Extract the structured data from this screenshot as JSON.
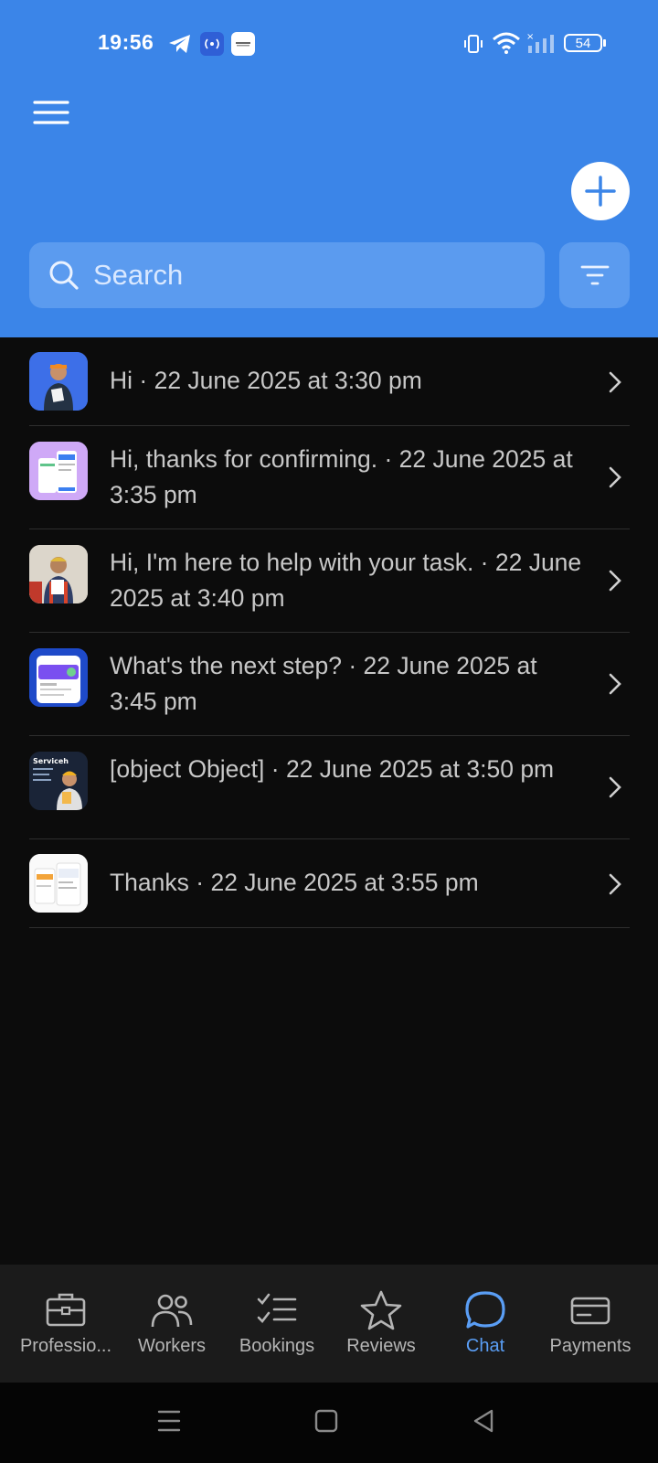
{
  "status_bar": {
    "time": "19:56",
    "battery": "54",
    "icons": [
      "telegram-icon",
      "hotspot-icon",
      "notification-app-icon",
      "vibrate-icon",
      "wifi-icon",
      "signal-icon",
      "battery-icon"
    ]
  },
  "header": {
    "menu_icon": "hamburger-menu-icon",
    "add_icon": "plus-icon",
    "accent_color": "#3b85e8"
  },
  "search": {
    "placeholder": "Search",
    "value": "",
    "filter_icon": "filter-icon"
  },
  "chats": [
    {
      "text": "Hi · 22 June 2025 at 3:30 pm",
      "avatar": "worker-with-clipboard"
    },
    {
      "text": "Hi, thanks for confirming. · 22 June 2025 at 3:35 pm",
      "avatar": "app-screens-purple"
    },
    {
      "text": "Hi, I'm here to help with your task. · 22 June 2025 at 3:40 pm",
      "avatar": "worker-photo"
    },
    {
      "text": "What's the next step? · 22 June 2025 at 3:45 pm",
      "avatar": "app-screen-blue"
    },
    {
      "text": "[object Object] · 22 June 2025 at 3:50 pm",
      "avatar": "servicehub-banner"
    },
    {
      "text": "Thanks · 22 June 2025 at 3:55 pm",
      "avatar": "app-screens-white"
    }
  ],
  "avatar_text": {
    "servicehub": "Serviceh"
  },
  "bottom_nav": [
    {
      "label": "Professio...",
      "icon": "briefcase-icon",
      "active": false
    },
    {
      "label": "Workers",
      "icon": "people-icon",
      "active": false
    },
    {
      "label": "Bookings",
      "icon": "checklist-icon",
      "active": false
    },
    {
      "label": "Reviews",
      "icon": "star-icon",
      "active": false
    },
    {
      "label": "Chat",
      "icon": "chat-bubble-icon",
      "active": true
    },
    {
      "label": "Payments",
      "icon": "card-icon",
      "active": false
    }
  ],
  "colors": {
    "active_nav": "#5a9ef5",
    "background": "#0c0c0c"
  }
}
